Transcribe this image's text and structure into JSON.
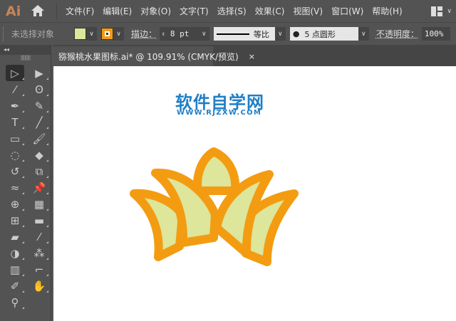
{
  "app": {
    "logo": "Ai",
    "menus": [
      "文件(F)",
      "编辑(E)",
      "对象(O)",
      "文字(T)",
      "选择(S)",
      "效果(C)",
      "视图(V)",
      "窗口(W)",
      "帮助(H)"
    ]
  },
  "control": {
    "selection": "未选择对象",
    "fill_color": "#dde69a",
    "stroke_color": "#f39c12",
    "stroke_label": "描边：",
    "stroke_value": "8 pt",
    "profile": "等比",
    "brush": "5 点圆形",
    "opacity_label": "不透明度：",
    "opacity_value": "100%"
  },
  "document": {
    "tab_title": "猕猴桃水果图标.ai* @ 109.91% (CMYK/预览)",
    "close": "×"
  },
  "toolbar": {
    "collapse": "◂◂",
    "tools": [
      "selection-tool",
      "direct-selection-tool",
      "magic-wand-tool",
      "lasso-tool",
      "pen-tool",
      "curvature-tool",
      "type-tool",
      "line-tool",
      "rectangle-tool",
      "paintbrush-tool",
      "shaper-tool",
      "eraser-tool",
      "rotate-tool",
      "scale-tool",
      "warp-tool",
      "puppet-warp-tool",
      "shape-builder-tool",
      "perspective-grid-tool",
      "mesh-tool",
      "gradient-tool",
      "measure-tool",
      "eyedropper-tool",
      "blend-tool",
      "symbol-sprayer-tool",
      "graph-tool",
      "artboard-tool",
      "slice-tool",
      "hand-tool",
      "zoom-tool"
    ]
  },
  "watermark": {
    "name": "软件自学网",
    "url": "WWW.RJZXW.COM"
  },
  "artwork": {
    "fill": "#dde69a",
    "stroke": "#f39c12"
  }
}
